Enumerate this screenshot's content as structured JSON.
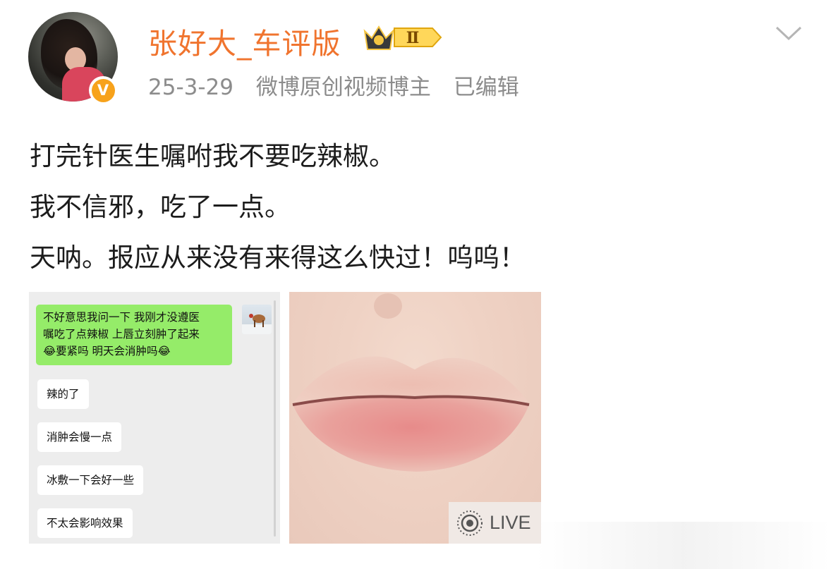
{
  "author": {
    "name": "张好大_车评版",
    "verified_badge": "V",
    "vip_level": "Ⅱ",
    "vip_icon": "crown-icon"
  },
  "meta": {
    "date": "25-3-29",
    "role": "微博原创视频博主",
    "edited": "已编辑"
  },
  "post": {
    "lines": [
      "打完针医生嘱咐我不要吃辣椒。",
      "我不信邪，吃了一点。",
      "天呐。报应从来没有来得这么快过！呜呜！"
    ]
  },
  "chat_image": {
    "my_message_lines": [
      "不好意思我问一下 我刚才没遵医",
      "嘱吃了点辣椒 上唇立刻肿了起来",
      "😂要紧吗 明天会消肿吗😂"
    ],
    "replies": [
      "辣的了",
      "消肿会慢一点",
      "冰敷一下会好一些",
      "不太会影响效果"
    ]
  },
  "live_badge": {
    "label": "LIVE",
    "icon": "live-photo-icon"
  },
  "colors": {
    "username": "#f0742e",
    "meta": "#8c8c8c",
    "bubble_green": "#95ec69",
    "badge_orange": "#f7a21b"
  }
}
